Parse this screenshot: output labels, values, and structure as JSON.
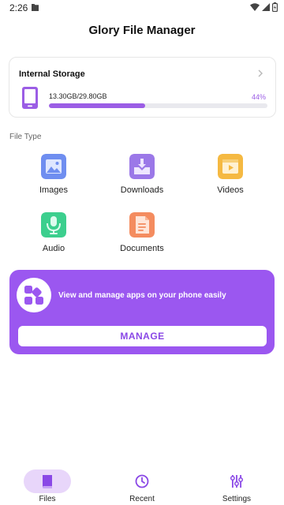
{
  "status_bar": {
    "time": "2:26",
    "icons": [
      "file-notification-icon",
      "wifi-icon",
      "signal-icon",
      "battery-icon"
    ]
  },
  "app": {
    "title": "Glory File Manager"
  },
  "storage": {
    "title": "Internal Storage",
    "used_label": "13.30GB/29.80GB",
    "percent_label": "44%",
    "fraction_used": 0.44,
    "icon": "phone-icon"
  },
  "file_types": {
    "section_label": "File Type",
    "items": [
      {
        "label": "Images",
        "icon": "image-icon",
        "color": "#6f8ef0"
      },
      {
        "label": "Downloads",
        "icon": "download-icon",
        "color": "#9b78e8"
      },
      {
        "label": "Videos",
        "icon": "video-icon",
        "color": "#f5b942"
      },
      {
        "label": "Audio",
        "icon": "microphone-icon",
        "color": "#3ccf8e"
      },
      {
        "label": "Documents",
        "icon": "document-icon",
        "color": "#f48c5f"
      }
    ]
  },
  "promo": {
    "text": "View and manage apps on your phone easily",
    "button_label": "MANAGE",
    "icon": "apps-grid-icon"
  },
  "bottom_nav": {
    "items": [
      {
        "label": "Files",
        "icon": "book-icon",
        "active": true
      },
      {
        "label": "Recent",
        "icon": "clock-icon",
        "active": false
      },
      {
        "label": "Settings",
        "icon": "sliders-icon",
        "active": false
      }
    ]
  },
  "colors": {
    "accent": "#9b5de5",
    "promo_background": "#9b57f0",
    "active_nav_pill": "#e8d6fa"
  }
}
